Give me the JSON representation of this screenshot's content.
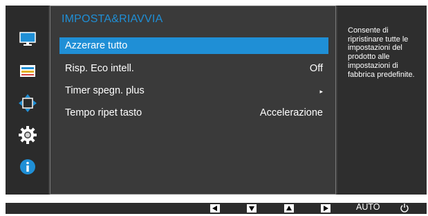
{
  "menu": {
    "title": "IMPOSTA&RIAVVIA",
    "items": [
      {
        "label": "Azzerare tutto",
        "value": ""
      },
      {
        "label": "Risp. Eco intell.",
        "value": "Off"
      },
      {
        "label": "Timer spegn. plus",
        "value": "▸"
      },
      {
        "label": "Tempo ripet tasto",
        "value": "Accelerazione"
      }
    ]
  },
  "help": {
    "text": "Consente di ripristinare tutte le impostazioni del prodotto alle impostazioni di fabbrica predefinite."
  },
  "sidebar": {
    "icons": [
      "monitor-icon",
      "color-bars-icon",
      "position-arrows-icon",
      "gear-icon",
      "info-icon"
    ]
  },
  "bottom_bar": {
    "keys": [
      "left-arrow-icon",
      "down-arrow-icon",
      "up-arrow-icon",
      "right-arrow-icon"
    ],
    "auto_label": "AUTO",
    "power_icon": "power-icon"
  },
  "colors": {
    "accent": "#1f8fd6",
    "background": "#3a3a3a"
  }
}
